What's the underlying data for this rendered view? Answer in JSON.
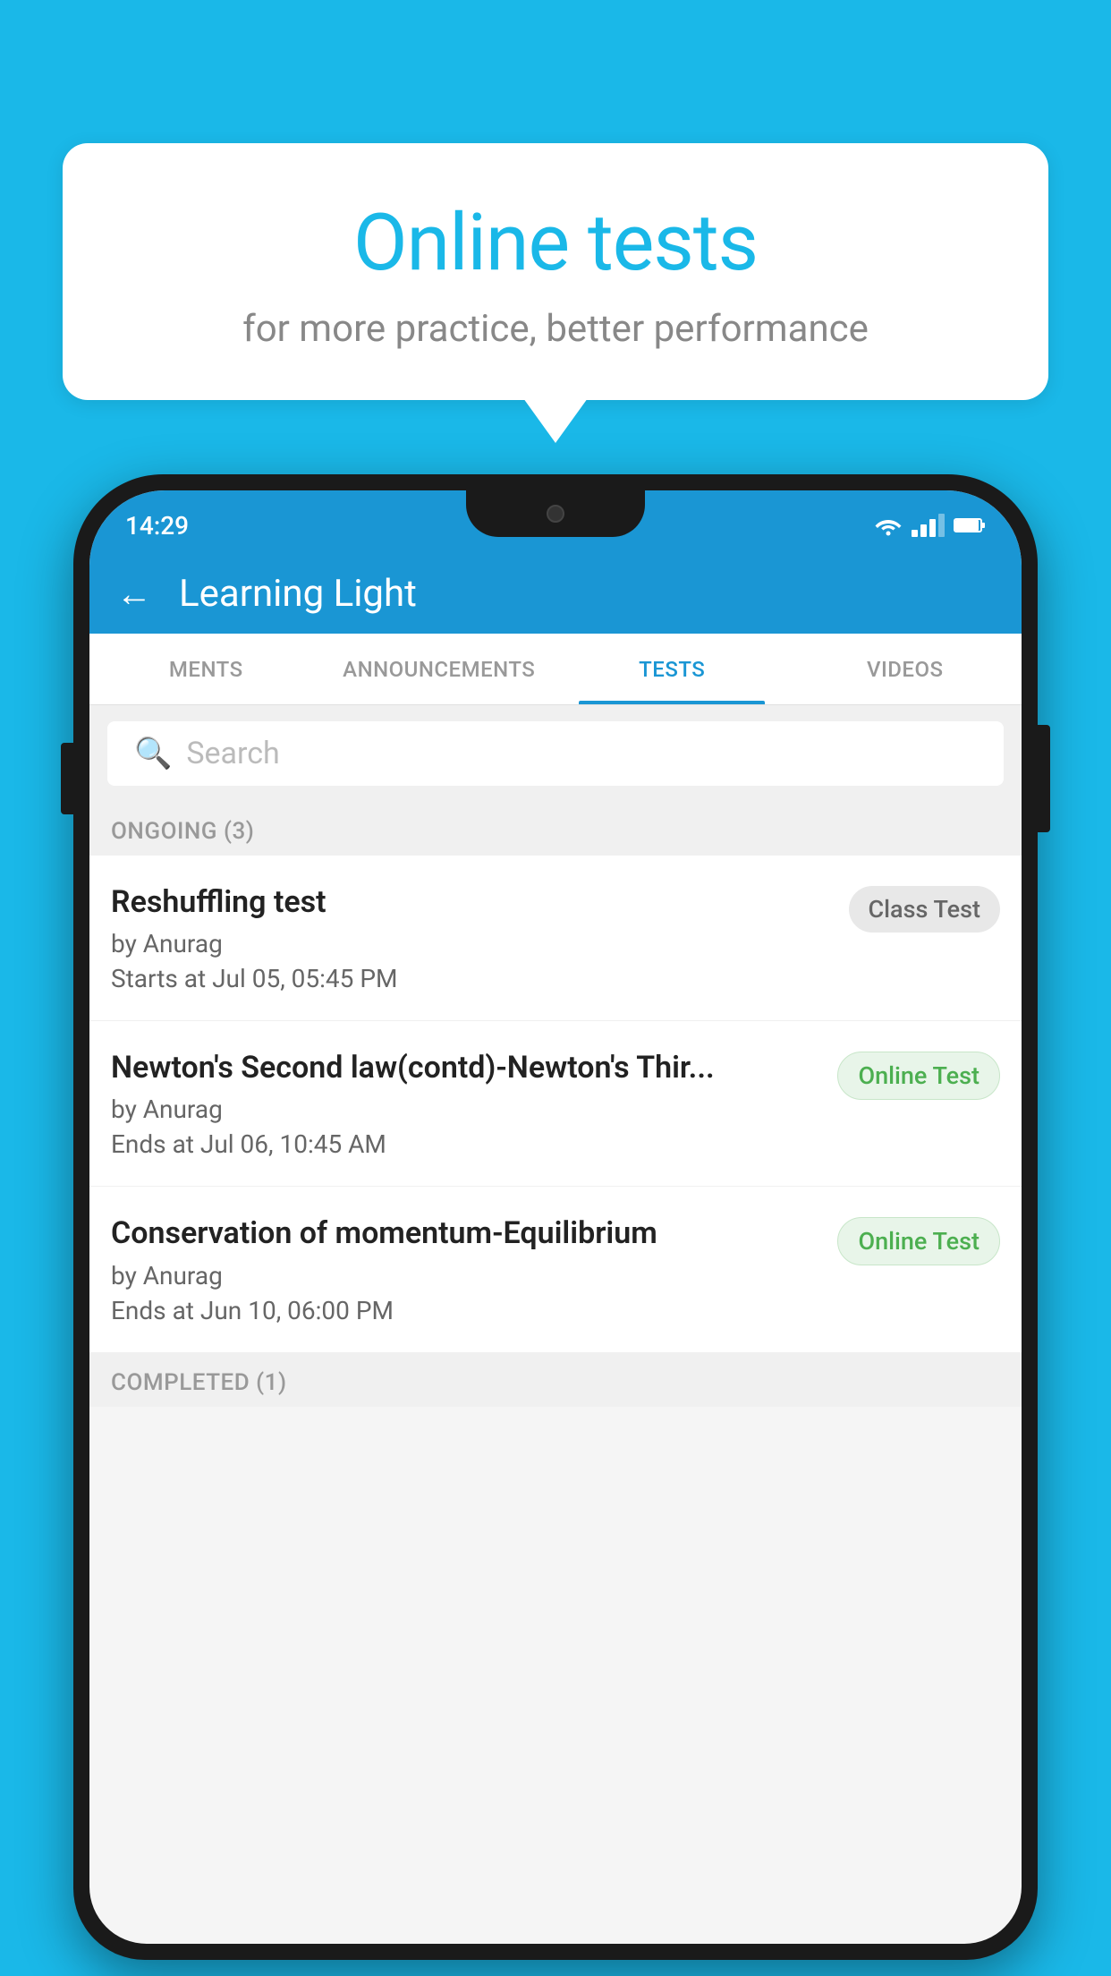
{
  "background_color": "#1ab8e8",
  "speech_bubble": {
    "title": "Online tests",
    "subtitle": "for more practice, better performance"
  },
  "phone": {
    "status_bar": {
      "time": "14:29",
      "icons": [
        "wifi",
        "signal",
        "battery"
      ]
    },
    "app_header": {
      "back_label": "←",
      "title": "Learning Light"
    },
    "tabs": [
      {
        "label": "MENTS",
        "active": false
      },
      {
        "label": "ANNOUNCEMENTS",
        "active": false
      },
      {
        "label": "TESTS",
        "active": true
      },
      {
        "label": "VIDEOS",
        "active": false
      }
    ],
    "search": {
      "placeholder": "Search"
    },
    "sections": [
      {
        "label": "ONGOING (3)",
        "tests": [
          {
            "name": "Reshuffling test",
            "author": "by Anurag",
            "time_label": "Starts at",
            "time_value": "Jul 05, 05:45 PM",
            "badge": "Class Test",
            "badge_type": "class"
          },
          {
            "name": "Newton's Second law(contd)-Newton's Thir...",
            "author": "by Anurag",
            "time_label": "Ends at",
            "time_value": "Jul 06, 10:45 AM",
            "badge": "Online Test",
            "badge_type": "online"
          },
          {
            "name": "Conservation of momentum-Equilibrium",
            "author": "by Anurag",
            "time_label": "Ends at",
            "time_value": "Jun 10, 06:00 PM",
            "badge": "Online Test",
            "badge_type": "online"
          }
        ]
      }
    ],
    "completed_label": "COMPLETED (1)"
  }
}
